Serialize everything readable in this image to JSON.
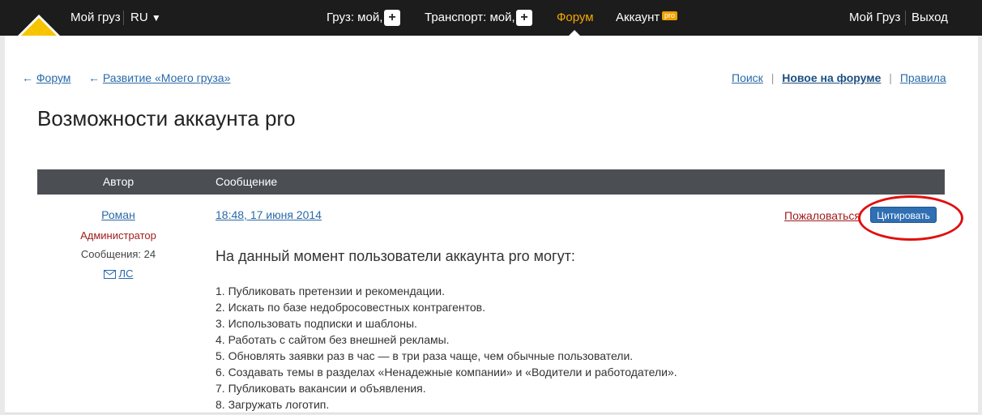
{
  "header": {
    "my_cargo": "Мой груз",
    "lang": "RU",
    "lang_arrow": "▼",
    "cargo_label": "Груз: мой,",
    "transport_label": "Транспорт: мой,",
    "plus": "+",
    "forum": "Форум",
    "account": "Аккаунт",
    "pro_badge": "pro",
    "my_cargo_right": "Мой Груз",
    "logout": "Выход"
  },
  "breadcrumb": {
    "arrow": "←",
    "forum": "Форум",
    "section": "Развитие «Моего груза»"
  },
  "top_links": {
    "search": "Поиск",
    "new_on_forum": "Новое на форуме",
    "rules": "Правила",
    "separator": "|"
  },
  "page_title": "Возможности аккаунта pro",
  "table": {
    "col_author": "Автор",
    "col_message": "Сообщение"
  },
  "post": {
    "author": "Роман",
    "role": "Администратор",
    "messages_count": "Сообщения: 24",
    "pm_label": "ЛС",
    "date": "18:48, 17 июня 2014",
    "complain": "Пожаловаться",
    "quote_button": "Цитировать",
    "heading": "На данный момент пользователи аккаунта pro могут:",
    "items": [
      "1. Публиковать претензии и рекомендации.",
      "2. Искать по базе недобросовестных контрагентов.",
      "3. Использовать подписки и шаблоны.",
      "4. Работать с сайтом без внешней рекламы.",
      "5. Обновлять заявки раз в час — в три раза чаще, чем обычные пользователи.",
      "6. Создавать темы в разделах «Ненадежные компании» и «Водители и работодатели».",
      "7. Публиковать вакансии и объявления.",
      "8. Загружать логотип."
    ]
  },
  "colors": {
    "topbar": "#1c1c1c",
    "active_nav": "#f5a800",
    "link": "#2a6aa8",
    "admin_red": "#a11d1d",
    "quote_button": "#2f6fb4",
    "annotation_circle": "#e01010"
  }
}
